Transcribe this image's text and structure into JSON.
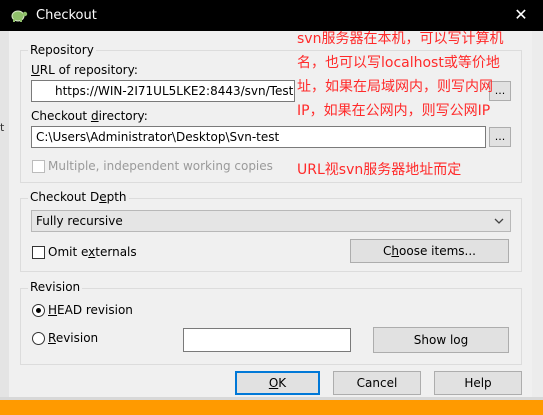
{
  "window": {
    "title": "Checkout",
    "close_symbol": "✕"
  },
  "left_glyph": "t",
  "repository": {
    "legend": "Repository",
    "url_label_u": "U",
    "url_label_rest": "RL of repository:",
    "url_value": "https://WIN-2I71UL5LKE2:8443/svn/Test",
    "dir_label_pre": "Checkout ",
    "dir_label_u": "d",
    "dir_label_rest": "irectory:",
    "dir_value": "C:\\Users\\Administrator\\Desktop\\Svn-test",
    "browse_label": "...",
    "multiple_label": "Multiple, independent working copies"
  },
  "annotation": {
    "line1": "svn服务器在本机，可以写计算机",
    "line2": "名，也可以写localhost或等价地",
    "line3": "址，如果在局域网内，则写内网",
    "line4": "IP，如果在公网内，则写公网IP",
    "line5": "URL视svn服务器地址而定"
  },
  "depth": {
    "legend_pre": "Checkout D",
    "legend_u": "e",
    "legend_rest": "pth",
    "selected": "Fully recursive",
    "omit_pre": "Omit e",
    "omit_u": "x",
    "omit_rest": "ternals",
    "choose_pre": "C",
    "choose_u": "h",
    "choose_rest": "oose items..."
  },
  "revision": {
    "legend": "Revision",
    "head_u": "H",
    "head_rest": "EAD revision",
    "rev_u": "R",
    "rev_rest": "evision",
    "rev_value": "",
    "show_log": "Show log"
  },
  "buttons": {
    "ok_u": "O",
    "ok_rest": "K",
    "cancel": "Cancel",
    "help": "Help"
  }
}
